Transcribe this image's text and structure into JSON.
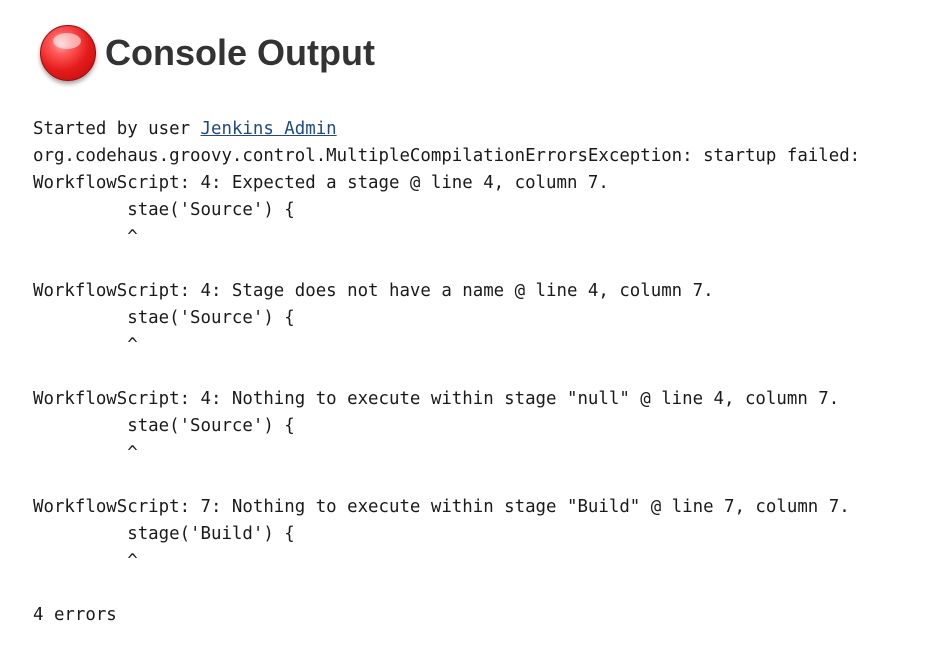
{
  "header": {
    "title": "Console Output",
    "status_icon": "red-ball-failed-icon",
    "status_color": "#e51b1b"
  },
  "console": {
    "started_prefix": "Started by user ",
    "user_link": "Jenkins Admin",
    "lines": [
      "org.codehaus.groovy.control.MultipleCompilationErrorsException: startup failed:",
      "WorkflowScript: 4: Expected a stage @ line 4, column 7.",
      "         stae('Source') {",
      "         ^",
      "",
      "WorkflowScript: 4: Stage does not have a name @ line 4, column 7.",
      "         stae('Source') {",
      "         ^",
      "",
      "WorkflowScript: 4: Nothing to execute within stage \"null\" @ line 4, column 7.",
      "         stae('Source') {",
      "         ^",
      "",
      "WorkflowScript: 7: Nothing to execute within stage \"Build\" @ line 7, column 7.",
      "         stage('Build') {",
      "         ^",
      "",
      "4 errors"
    ]
  }
}
